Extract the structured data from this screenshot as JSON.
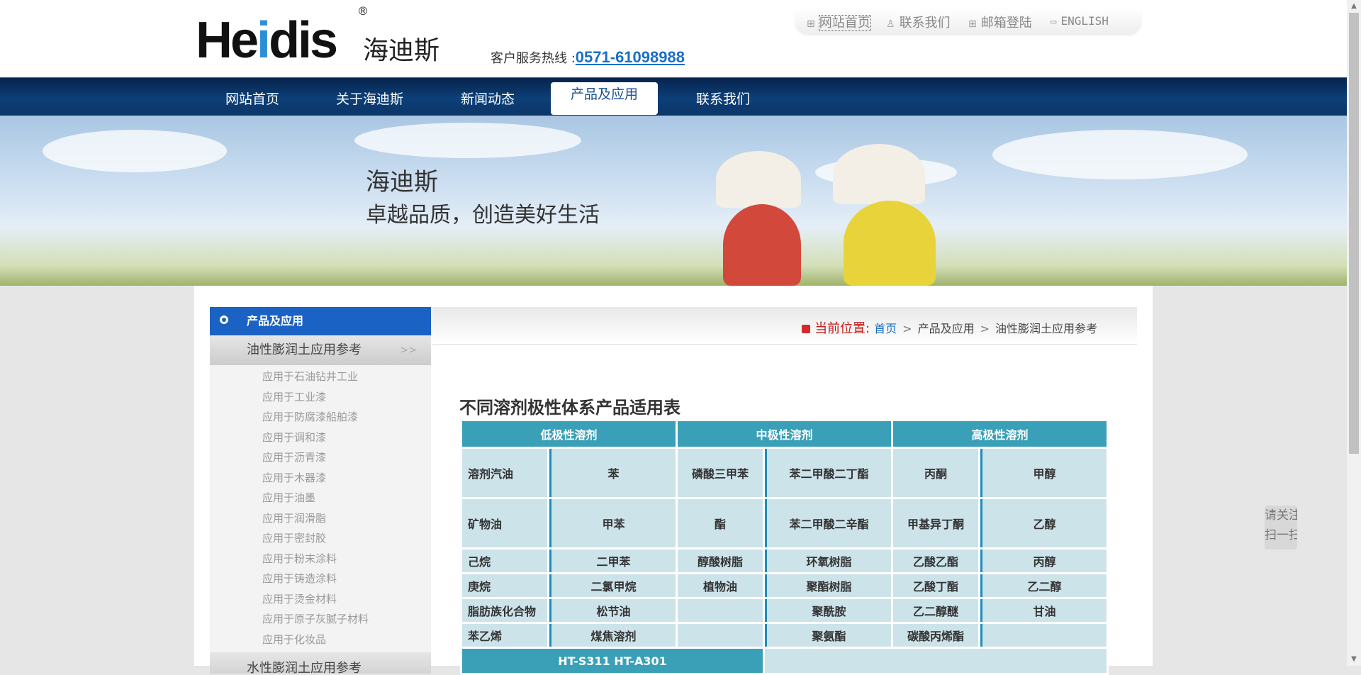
{
  "header": {
    "logo": {
      "brand_pre": "He",
      "brand_i": "i",
      "brand_post": "dis",
      "registered": "®",
      "cn_name": "海迪斯"
    },
    "hotline_label": "客户服务热线 :",
    "hotline_number": "0571-61098988",
    "top_links": [
      "网站首页",
      "联系我们",
      "邮箱登陆",
      "ENGLISH"
    ]
  },
  "nav": {
    "items": [
      "网站首页",
      "关于海迪斯",
      "新闻动态",
      "产品及应用",
      "联系我们"
    ],
    "active": "产品及应用"
  },
  "banner": {
    "title": "海迪斯",
    "subtitle": "卓越品质，创造美好生活"
  },
  "sidebar": {
    "header": "产品及应用",
    "category": "油性膨润土应用参考",
    "category_arrow": ">>",
    "items": [
      "应用于石油钻井工业",
      "应用于工业漆",
      "应用于防腐漆船舶漆",
      "应用于调和漆",
      "应用于沥青漆",
      "应用于木器漆",
      "应用于油墨",
      "应用于润滑脂",
      "应用于密封胶",
      "应用于粉末涂料",
      "应用于铸造涂料",
      "应用于烫金材料",
      "应用于原子灰腻子材料",
      "应用于化妆品"
    ],
    "next_category": "水性膨润土应用参考"
  },
  "breadcrumb": {
    "label": "当前位置:",
    "items": [
      "首页",
      "产品及应用",
      "油性膨润土应用参考"
    ]
  },
  "article": {
    "table_title": "不同溶剂极性体系产品适用表",
    "headers": [
      "低极性溶剂",
      "中极性溶剂",
      "高极性溶剂"
    ],
    "rows": [
      [
        "溶剂汽油",
        "苯",
        "磷酸三甲苯",
        "苯二甲酸二丁酯",
        "丙酮",
        "甲醇"
      ],
      [
        "矿物油",
        "甲苯",
        "酯",
        "苯二甲酸二辛酯",
        "甲基异丁酮",
        "乙醇"
      ],
      [
        "己烷",
        "二甲苯",
        "醇酸树脂",
        "环氧树脂",
        "乙酸乙酯",
        "丙醇"
      ],
      [
        "庚烷",
        "二氯甲烷",
        "植物油",
        "聚酯树脂",
        "乙酸丁酯",
        "乙二醇"
      ],
      [
        "脂肪族化合物",
        "松节油",
        "",
        "聚酰胺",
        "乙二醇醚",
        "甘油"
      ],
      [
        "苯乙烯",
        "煤焦溶剂",
        "",
        "聚氨酯",
        "碳酸丙烯酯",
        ""
      ]
    ],
    "product_row": "HT-S311  HT-A301"
  },
  "float_widget": {
    "line1": "请关注",
    "line2": "扫一扫"
  }
}
